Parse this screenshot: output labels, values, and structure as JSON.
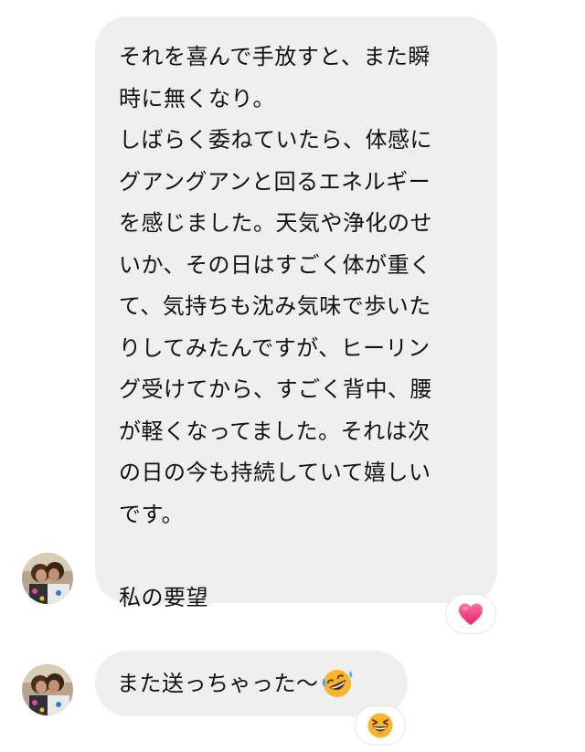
{
  "messages": [
    {
      "text": "それを喜んで手放すと、また瞬\n時に無くなり。\nしばらく委ねていたら、体感に\nグアングアンと回るエネルギー\nを感じました。天気や浄化のせ\nいか、その日はすごく体が重く\nて、気持ちも沈み気味で歩いた\nりしてみたんですが、ヒーリン\nグ受けてから、すごく背中、腰\nが軽くなってました。それは次\nの日の今も持続していて嬉しい\nです。\n\n私の要望",
      "reaction": "heart-icon"
    },
    {
      "text": "また送っちゃった〜",
      "trailing_emoji": "rolling-on-floor-laughing-emoji",
      "reaction": "grinning-squinting-face-emoji"
    }
  ],
  "colors": {
    "bubble_bg": "#efefef",
    "text": "#111111",
    "heart": "#f0407a",
    "emoji_yellow": "#f8b62c"
  }
}
